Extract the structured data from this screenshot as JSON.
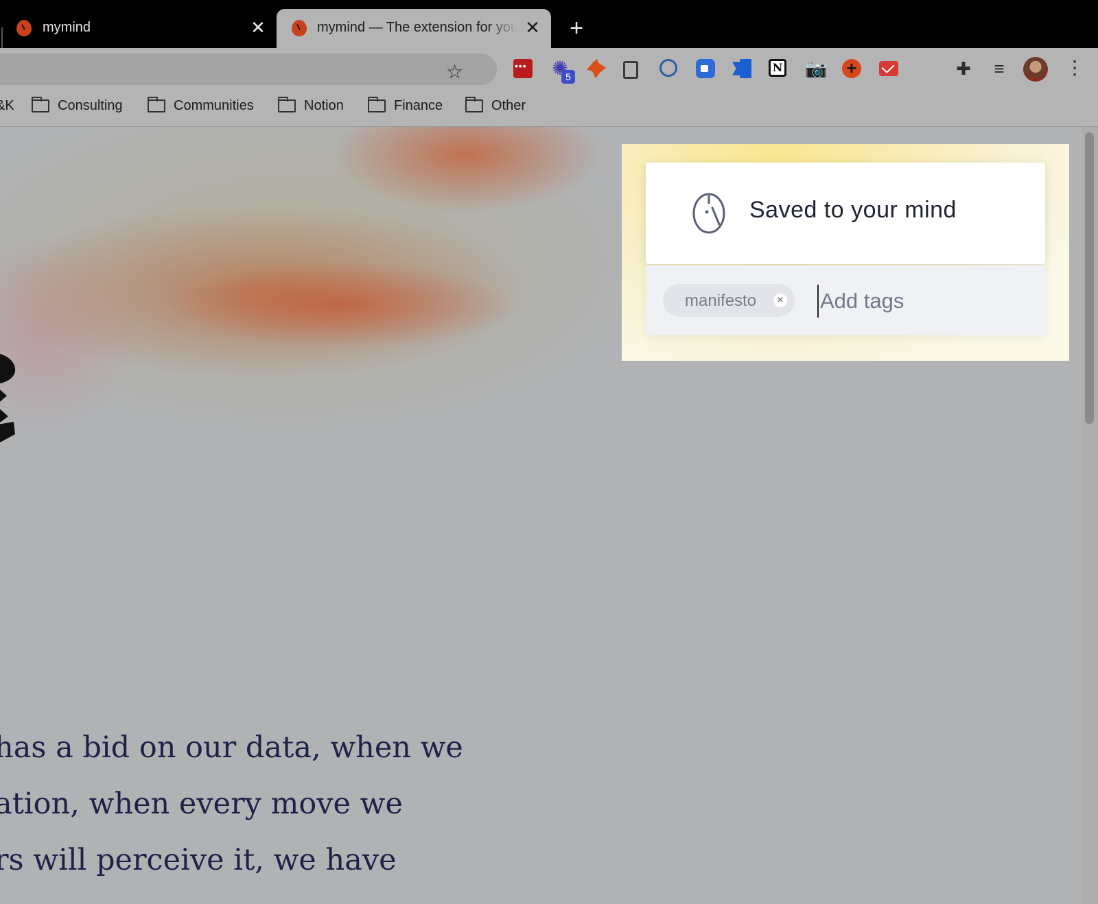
{
  "tabs": [
    {
      "title": "mymind",
      "close": "✕"
    },
    {
      "title": "mymind — The extension for your mind",
      "close": "✕"
    }
  ],
  "new_tab": "+",
  "toolbar": {
    "star": "☆",
    "extension_badge": "5",
    "ext_glyphs": {
      "burst": "✺",
      "camera": "📷",
      "plus": "+",
      "notion": "N",
      "puzzle": "✚",
      "media": "≡",
      "menu": "⋮"
    },
    "extension_icons": [
      "red-dots-icon",
      "blue-burst-icon",
      "orange-fox-icon",
      "document-icon",
      "key-lock-icon",
      "zoom-video-icon",
      "blue-flag-icon",
      "notion-icon",
      "camera-icon",
      "plus-circle-icon",
      "mail-icon",
      "puzzle-icon",
      "media-list-icon"
    ]
  },
  "bookmarks": [
    {
      "label": "&K"
    },
    {
      "label": "Consulting"
    },
    {
      "label": "Communities"
    },
    {
      "label": "Notion"
    },
    {
      "label": "Finance"
    },
    {
      "label": "Other"
    }
  ],
  "page": {
    "lines": [
      "has a bid on our data, when we",
      "ation, when every move we",
      "rs will perceive it, we have"
    ]
  },
  "popup": {
    "title": "Saved to your mind",
    "tags": [
      {
        "label": "manifesto",
        "remove": "×"
      }
    ],
    "input_placeholder": "Add tags"
  },
  "colors": {
    "brand": "#c8431d",
    "text_dark": "#1d2347",
    "popup_glow": "#ffe98c"
  }
}
